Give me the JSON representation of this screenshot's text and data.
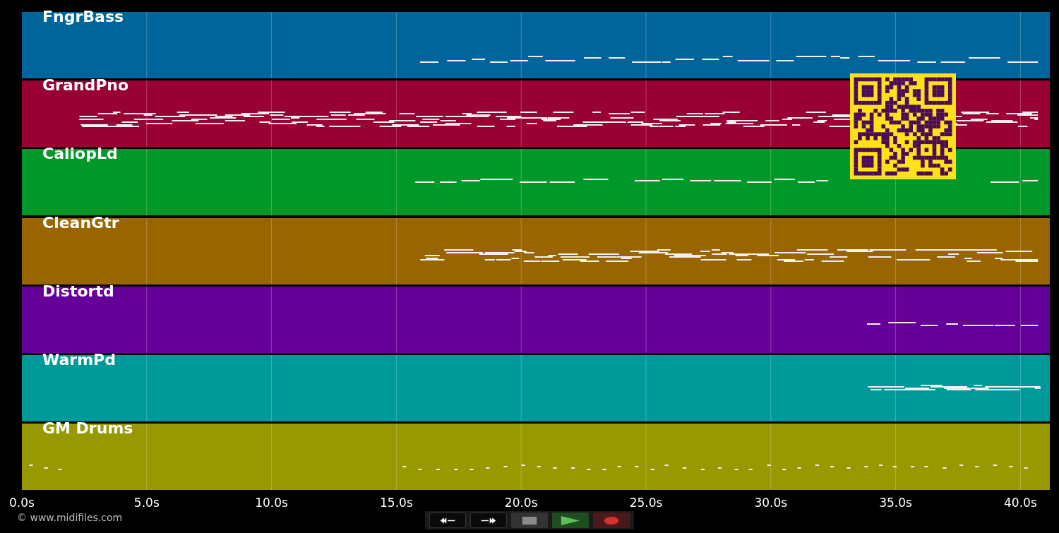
{
  "tracks": [
    {
      "name": "FngrBass",
      "color": "#00659a"
    },
    {
      "name": "GrandPno",
      "color": "#990033"
    },
    {
      "name": "CaliopLd",
      "color": "#009929"
    },
    {
      "name": "CleanGtr",
      "color": "#986500"
    },
    {
      "name": "Distortd",
      "color": "#650099"
    },
    {
      "name": "WarmPd",
      "color": "#00999a"
    },
    {
      "name": "GM Drums",
      "color": "#989900"
    }
  ],
  "axis": {
    "ticks": [
      "0.0s",
      "5.0s",
      "10.0s",
      "15.0s",
      "20.0s",
      "25.0s",
      "30.0s",
      "35.0s",
      "40.0s"
    ]
  },
  "copyright": "© www.midifiles.com",
  "controls": [
    {
      "kind": "rewind"
    },
    {
      "kind": "forward"
    },
    {
      "kind": "stop"
    },
    {
      "kind": "play"
    },
    {
      "kind": "record"
    }
  ]
}
